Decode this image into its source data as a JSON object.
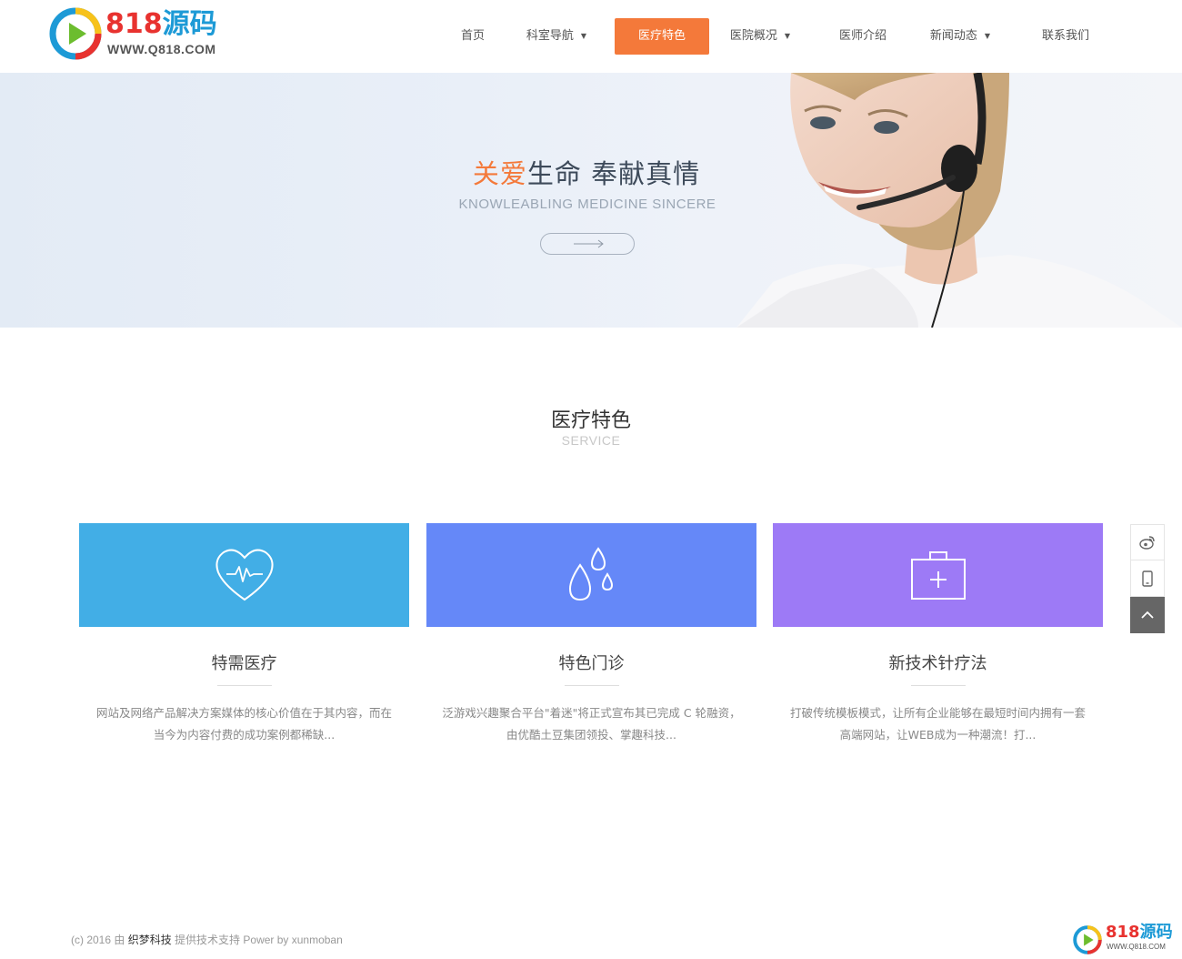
{
  "logo": {
    "digits": "818",
    "chars": "源码",
    "site": "WWW.Q818.COM"
  },
  "nav": [
    {
      "label": "首页",
      "dropdown": false,
      "active": false
    },
    {
      "label": "科室导航",
      "dropdown": true,
      "active": false
    },
    {
      "label": "医疗特色",
      "dropdown": false,
      "active": true
    },
    {
      "label": "医院概况",
      "dropdown": true,
      "active": false
    },
    {
      "label": "医师介绍",
      "dropdown": false,
      "active": false
    },
    {
      "label": "新闻动态",
      "dropdown": true,
      "active": false
    },
    {
      "label": "联系我们",
      "dropdown": false,
      "active": false
    }
  ],
  "banner": {
    "title_highlight": "关爱",
    "title_rest": "生命 奉献真情",
    "subtitle": "KNOWLEABLING MEDICINE SINCERE",
    "button_icon": "long-arrow-right-icon"
  },
  "section": {
    "title": "医疗特色",
    "subtitle": "SERVICE"
  },
  "cards": [
    {
      "title": "特需医疗",
      "desc": "网站及网络产品解决方案媒体的核心价值在于其内容，而在当今为内容付费的成功案例都稀缺...",
      "color": "#42aee6",
      "icon": "heart-pulse-icon"
    },
    {
      "title": "特色门诊",
      "desc": "泛游戏兴趣聚合平台\"着迷\"将正式宣布其已完成 C 轮融资，由优酷土豆集团领投、掌趣科技...",
      "color": "#6588f8",
      "icon": "water-drops-icon"
    },
    {
      "title": "新技术针疗法",
      "desc": "打破传统模板模式，让所有企业能够在最短时间内拥有一套高端网站，让WEB成为一种潮流！打...",
      "color": "#9d7af6",
      "icon": "medical-kit-icon"
    }
  ],
  "side_tools": [
    "weibo-icon",
    "mobile-icon",
    "back-to-top-icon"
  ],
  "footer": {
    "prefix": "(c) 2016 由 ",
    "link": "织梦科技",
    "suffix": " 提供技术支持 Power by xunmoban"
  },
  "watermark": {
    "digits": "818",
    "chars": "源码",
    "site": "WWW.Q818.COM"
  },
  "colors": {
    "accent": "#f4793a",
    "logo_red": "#e8322f",
    "logo_blue": "#1d9ad6"
  }
}
